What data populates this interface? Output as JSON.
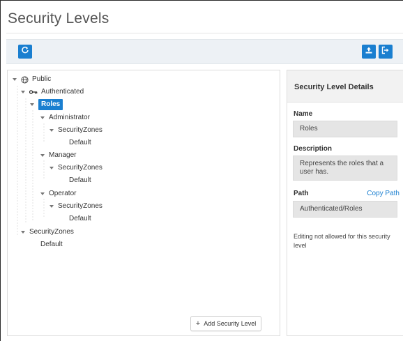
{
  "page": {
    "title": "Security Levels"
  },
  "toolbar": {
    "refresh_icon": "refresh-icon",
    "upload_icon": "upload-icon",
    "exit_icon": "exit-icon",
    "accent": "#1a7fd0"
  },
  "tree": {
    "public": "Public",
    "authenticated": "Authenticated",
    "roles": "Roles",
    "administrator": "Administrator",
    "admin_zones": "SecurityZones",
    "admin_default": "Default",
    "manager": "Manager",
    "manager_zones": "SecurityZones",
    "manager_default": "Default",
    "operator": "Operator",
    "operator_zones": "SecurityZones",
    "operator_default": "Default",
    "top_zones": "SecurityZones",
    "top_default": "Default",
    "selected": "Roles"
  },
  "add_button": {
    "label": "Add Security Level",
    "icon": "plus-icon"
  },
  "details": {
    "title": "Security Level Details",
    "name_label": "Name",
    "name_value": "Roles",
    "description_label": "Description",
    "description_value": "Represents the roles that a user has.",
    "path_label": "Path",
    "copy_path": "Copy Path",
    "path_value": "Authenticated/Roles",
    "note": "Editing not allowed for this security level"
  }
}
